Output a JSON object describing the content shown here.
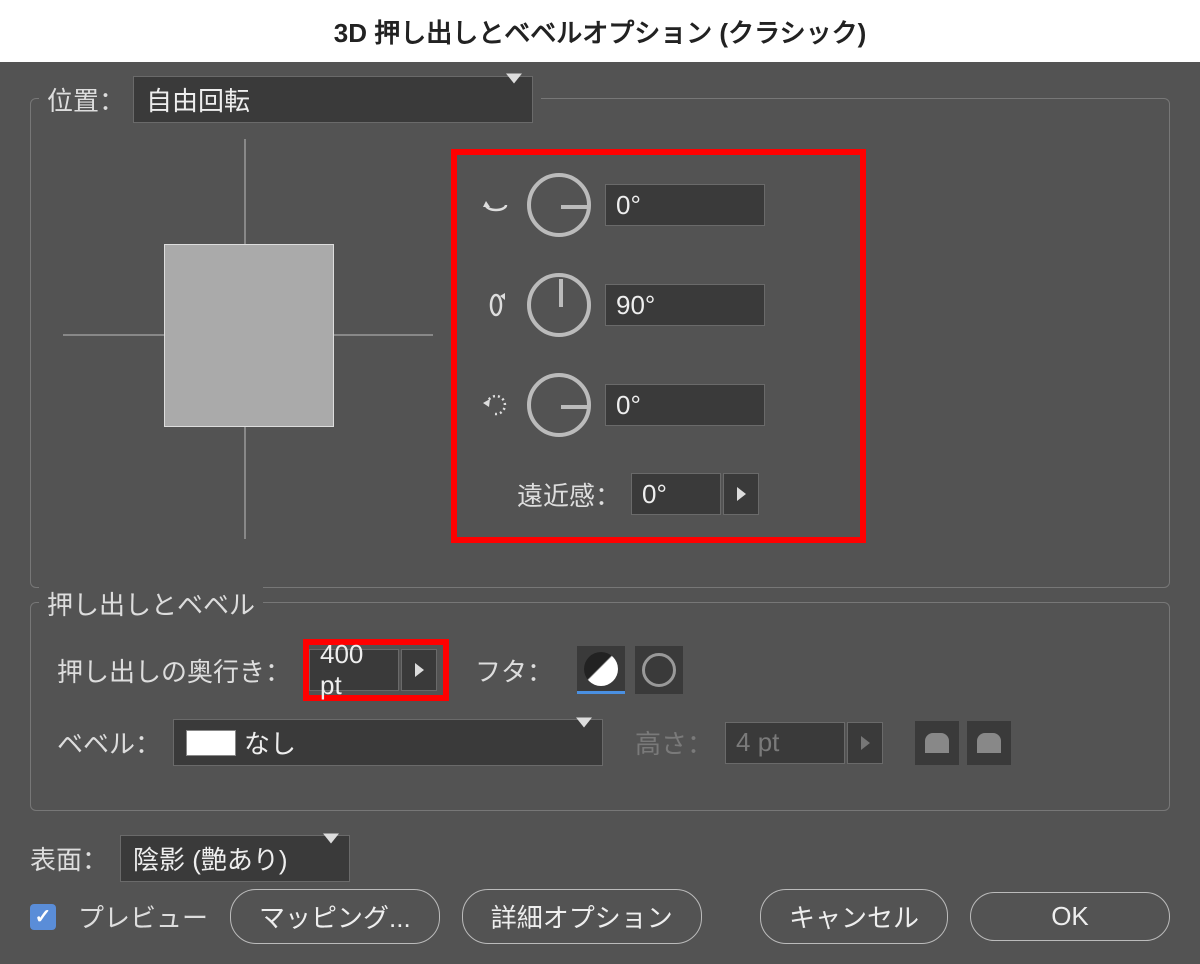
{
  "title": "3D 押し出しとベベルオプション (クラシック)",
  "position": {
    "label": "位置：",
    "value": "自由回転"
  },
  "rotation": {
    "x": "0°",
    "y": "90°",
    "z": "0°"
  },
  "perspective": {
    "label": "遠近感：",
    "value": "0°"
  },
  "extrude_bevel": {
    "group_label": "押し出しとベベル",
    "depth_label": "押し出しの奥行き：",
    "depth_value": "400 pt",
    "cap_label": "フタ：",
    "bevel_label": "ベベル：",
    "bevel_value": "なし",
    "height_label": "高さ：",
    "height_value": "4 pt"
  },
  "surface": {
    "label": "表面：",
    "value": "陰影 (艶あり)"
  },
  "footer": {
    "preview": "プレビュー",
    "mapping": "マッピング...",
    "more_options": "詳細オプション",
    "cancel": "キャンセル",
    "ok": "OK"
  }
}
